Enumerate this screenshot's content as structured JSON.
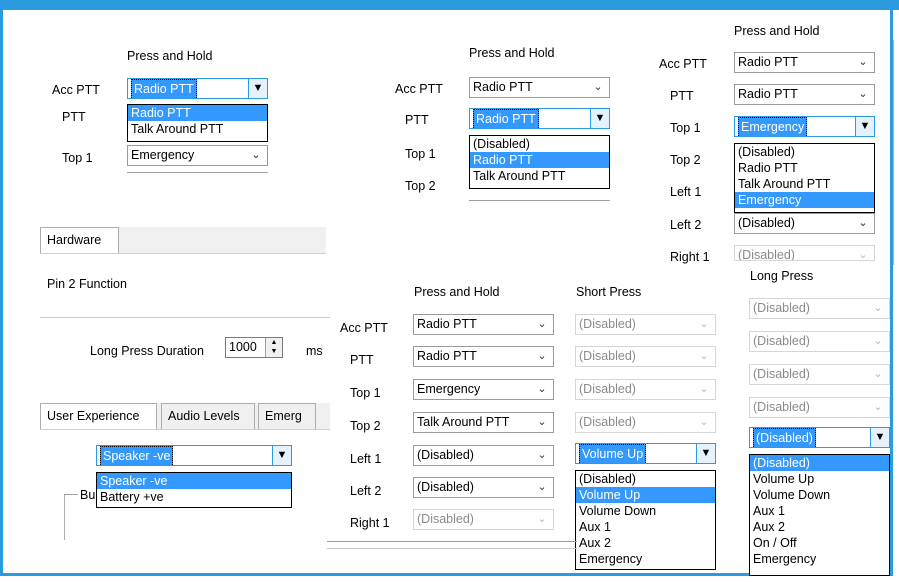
{
  "common": {
    "press_and_hold": "Press and Hold",
    "short_press": "Short Press",
    "long_press": "Long Press",
    "acc_ptt": "Acc PTT",
    "ptt": "PTT",
    "top1": "Top 1",
    "top2": "Top 2",
    "left1": "Left 1",
    "left2": "Left 2",
    "right1": "Right 1",
    "radio_ptt": "Radio PTT",
    "talk_around_ptt": "Talk Around PTT",
    "emergency": "Emergency",
    "disabled": "(Disabled)",
    "volume_up": "Volume Up",
    "volume_down": "Volume Down",
    "aux1": "Aux 1",
    "aux2": "Aux 2",
    "on_off": "On / Off"
  },
  "hardware": {
    "tab": "Hardware",
    "pin2_label": "Pin 2 Function",
    "long_press_duration_label": "Long Press Duration",
    "long_press_duration_value": "1000",
    "unit": "ms"
  },
  "tabs2": {
    "user_experience": "User Experience",
    "audio_levels": "Audio Levels",
    "emergency": "Emerg"
  },
  "speaker": {
    "selected": "Speaker -ve",
    "options": [
      "Speaker -ve",
      "Battery +ve"
    ],
    "group_label": "Bu"
  }
}
